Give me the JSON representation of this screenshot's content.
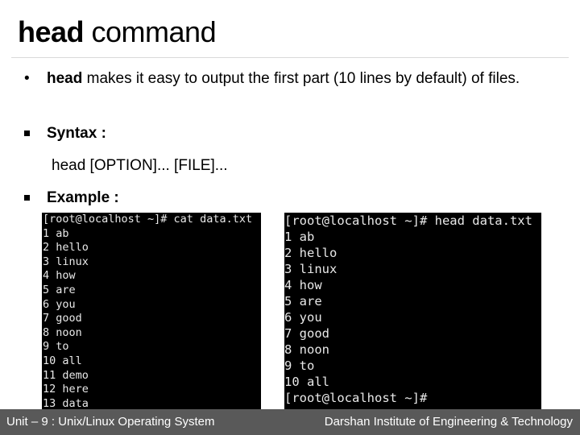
{
  "title": {
    "bold": "head",
    "rest": " command"
  },
  "bullets": {
    "intro_bold": "head",
    "intro_rest": " makes it easy to output the first part (10 lines by default) of files.",
    "syntax_label": "Syntax :",
    "syntax_value": "head [OPTION]... [FILE]...",
    "example_label": "Example :"
  },
  "terminal_left": {
    "lines": [
      "[root@localhost ~]# cat data.txt",
      "1 ab",
      "2 hello",
      "3 linux",
      "4 how",
      "5 are",
      "6 you",
      "7 good",
      "8 noon",
      "9 to",
      "10 all",
      "11 demo",
      "12 here",
      "13 data"
    ]
  },
  "terminal_right": {
    "lines": [
      "[root@localhost ~]# head data.txt",
      "1 ab",
      "2 hello",
      "3 linux",
      "4 how",
      "5 are",
      "6 you",
      "7 good",
      "8 noon",
      "9 to",
      "10 all",
      "[root@localhost ~]#"
    ]
  },
  "footer": {
    "left": "Unit – 9 : Unix/Linux Operating System",
    "right": "Darshan Institute of Engineering & Technology"
  }
}
